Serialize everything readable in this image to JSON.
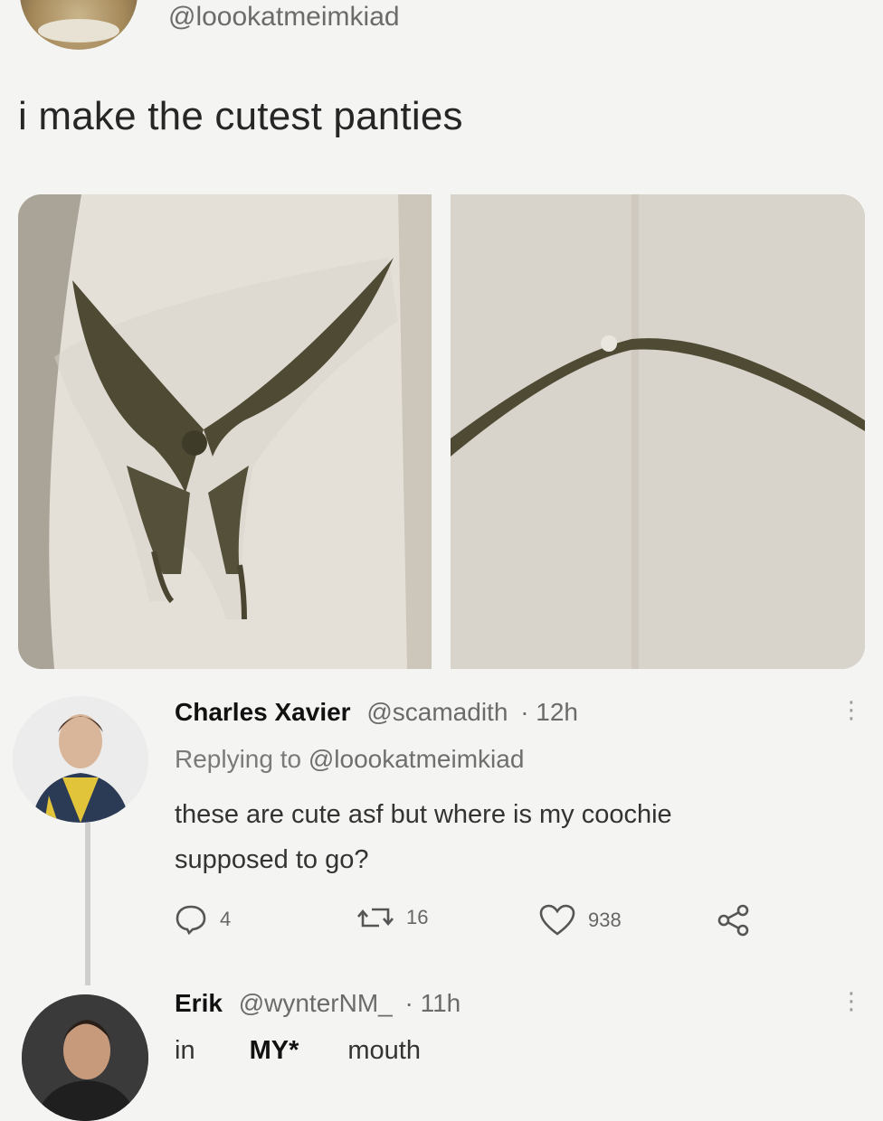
{
  "tweet": {
    "handle": "@loookatmeimkiad",
    "text": "i make the cutest panties"
  },
  "replies": [
    {
      "name": "Charles Xavier",
      "handle": "@scamadith",
      "time": "· 12h",
      "replying_prefix": "Replying to",
      "replying_to": "@loookatmeimkiad",
      "text_line1": "these are cute asf but where is my coochie",
      "text_line2": "supposed to go?",
      "actions": {
        "reply_count": "4",
        "retweet_count": "16",
        "like_count": "938"
      }
    },
    {
      "name": "Erik",
      "handle": "@wynterNM_",
      "time": "· 11h",
      "text_start": "in",
      "text_caps": "MY*",
      "text_end": "mouth"
    }
  ],
  "icons": {
    "reply": "comment-bubble-icon",
    "retweet": "retweet-icon",
    "like": "heart-icon",
    "share": "share-icon",
    "more": "vertical-dots-icon"
  }
}
